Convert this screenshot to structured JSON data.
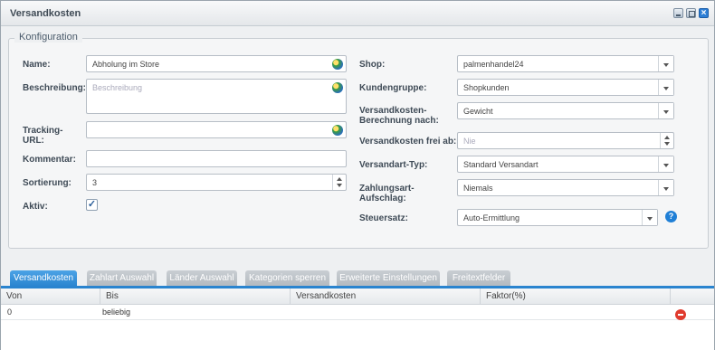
{
  "window": {
    "title": "Versandkosten"
  },
  "form": {
    "legend": "Konfiguration",
    "left": {
      "name_label": "Name:",
      "name_value": "Abholung im Store",
      "description_label": "Beschreibung:",
      "description_placeholder": "Beschreibung",
      "tracking_label": "Tracking-\nURL:",
      "comment_label": "Kommentar:",
      "sort_label": "Sortierung:",
      "sort_value": "3",
      "active_label": "Aktiv:",
      "active_checked": "✓"
    },
    "right": {
      "shop_label": "Shop:",
      "shop_value": "palmenhandel24",
      "customergroup_label": "Kundengruppe:",
      "customergroup_value": "Shopkunden",
      "calc_label": "Versandkosten-\nBerechnung nach:",
      "calc_value": "Gewicht",
      "free_label": "Versandkosten frei ab:",
      "free_placeholder": "Nie",
      "type_label": "Versandart-Typ:",
      "type_value": "Standard Versandart",
      "surcharge_label": "Zahlungsart-\nAufschlag:",
      "surcharge_value": "Niemals",
      "tax_label": "Steuersatz:",
      "tax_value": "Auto-Ermittlung",
      "help_glyph": "?"
    }
  },
  "tabs": [
    {
      "label": "Versandkosten",
      "active": true
    },
    {
      "label": "Zahlart Auswahl",
      "active": false
    },
    {
      "label": "Länder Auswahl",
      "active": false
    },
    {
      "label": "Kategorien sperren",
      "active": false
    },
    {
      "label": "Erweiterte Einstellungen",
      "active": false
    },
    {
      "label": "Freitextfelder",
      "active": false
    }
  ],
  "grid": {
    "columns": [
      "Von",
      "Bis",
      "Versandkosten",
      "Faktor(%)"
    ],
    "rows": [
      {
        "von": "0",
        "bis": "beliebig",
        "versandkosten": "",
        "faktor": ""
      }
    ]
  },
  "colors": {
    "accent": "#2a84cf",
    "delete": "#e03b2e"
  },
  "icons": [
    "minimize-icon",
    "maximize-icon",
    "close-icon",
    "globe-icon",
    "help-icon",
    "delete-icon",
    "checkmark-icon"
  ]
}
